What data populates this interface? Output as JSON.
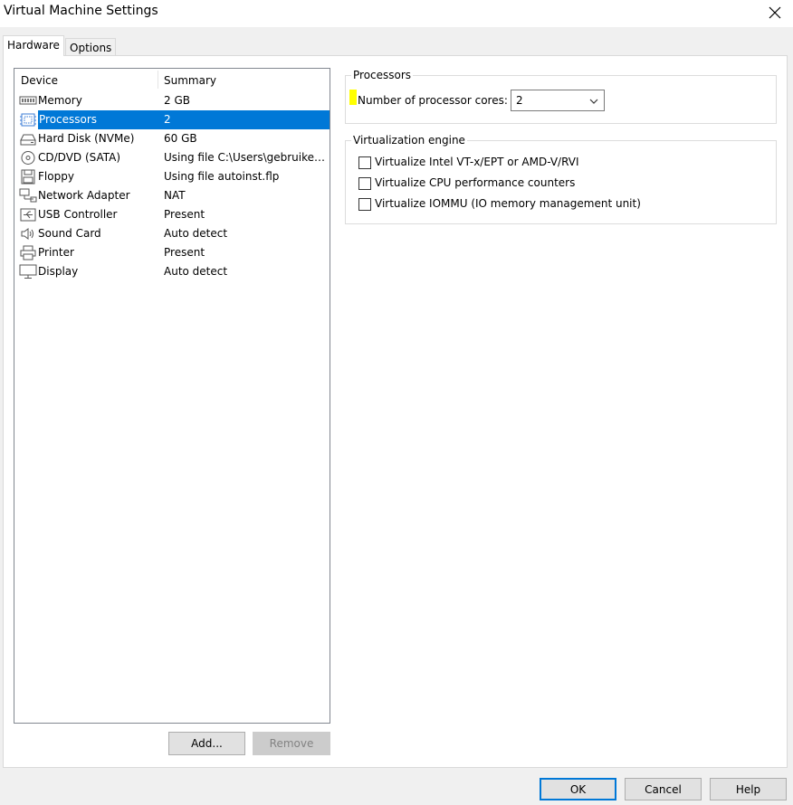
{
  "window": {
    "title": "Virtual Machine Settings"
  },
  "tabs": {
    "hardware": "Hardware",
    "options": "Options"
  },
  "list": {
    "header_device": "Device",
    "header_summary": "Summary",
    "items": [
      {
        "device": "Memory",
        "summary": "2 GB",
        "icon": "memory-icon"
      },
      {
        "device": "Processors",
        "summary": "2",
        "icon": "processor-icon"
      },
      {
        "device": "Hard Disk (NVMe)",
        "summary": "60 GB",
        "icon": "hard-disk-icon"
      },
      {
        "device": "CD/DVD (SATA)",
        "summary": "Using file C:\\Users\\gebruiker...",
        "icon": "cd-dvd-icon"
      },
      {
        "device": "Floppy",
        "summary": "Using file autoinst.flp",
        "icon": "floppy-icon"
      },
      {
        "device": "Network Adapter",
        "summary": "NAT",
        "icon": "network-adapter-icon"
      },
      {
        "device": "USB Controller",
        "summary": "Present",
        "icon": "usb-icon"
      },
      {
        "device": "Sound Card",
        "summary": "Auto detect",
        "icon": "speaker-icon"
      },
      {
        "device": "Printer",
        "summary": "Present",
        "icon": "printer-icon"
      },
      {
        "device": "Display",
        "summary": "Auto detect",
        "icon": "monitor-icon"
      }
    ],
    "selected": "Processors"
  },
  "buttons": {
    "add": "Add...",
    "remove": "Remove",
    "ok": "OK",
    "cancel": "Cancel",
    "help": "Help"
  },
  "processors": {
    "group_title": "Processors",
    "cores_label": "Number of processor cores:",
    "cores_value": "2"
  },
  "virtualization": {
    "group_title": "Virtualization engine",
    "options": [
      {
        "label": "Virtualize Intel VT-x/EPT or AMD-V/RVI",
        "checked": false
      },
      {
        "label": "Virtualize CPU performance counters",
        "checked": false
      },
      {
        "label": "Virtualize IOMMU (IO memory management unit)",
        "checked": false
      }
    ]
  },
  "colors": {
    "selection": "#0078d7",
    "highlight": "#ffff00"
  }
}
